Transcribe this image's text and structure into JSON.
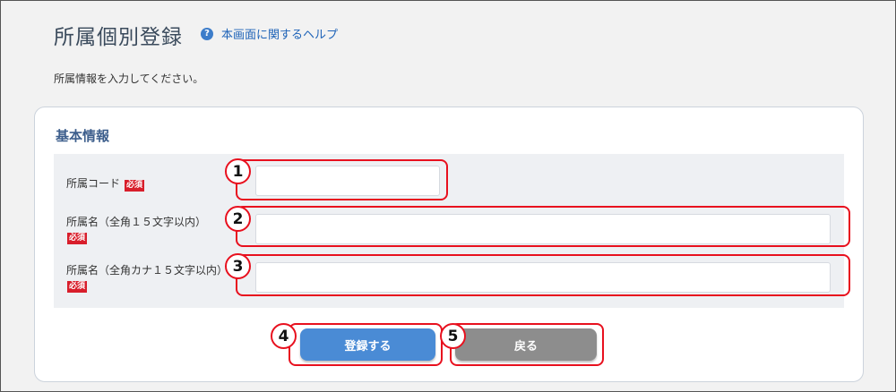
{
  "page": {
    "title": "所属個別登録",
    "help_link": "本画面に関するヘルプ",
    "description": "所属情報を入力してください。"
  },
  "card": {
    "title": "基本情報"
  },
  "form": {
    "required_badge": "必須",
    "fields": [
      {
        "label": "所属コード",
        "value": "",
        "annotation": "1"
      },
      {
        "label": "所属名（全角１５文字以内）",
        "value": "",
        "annotation": "2"
      },
      {
        "label": "所属名（全角カナ１５文字以内）",
        "value": "",
        "annotation": "3"
      }
    ]
  },
  "buttons": {
    "register": {
      "label": "登録する",
      "annotation": "4"
    },
    "back": {
      "label": "戻る",
      "annotation": "5"
    }
  },
  "colors": {
    "primary_button": "#4a8bd5",
    "secondary_button": "#8d8d8d",
    "required_badge": "#d81e2b",
    "annotation": "#e8101e",
    "link": "#1e63b8"
  },
  "icons": {
    "help": "question-circle-icon"
  }
}
